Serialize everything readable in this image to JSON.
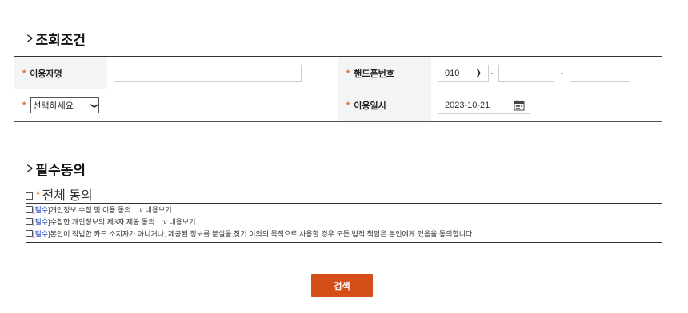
{
  "section1": {
    "title": "조회조건"
  },
  "conditions": {
    "user_name_label": "이용자명",
    "user_name_value": "",
    "phone_label": "핸드폰번호",
    "phone_prefix": "010",
    "phone_dash1": "-",
    "phone_dash2": "-",
    "phone_mid": "",
    "phone_last": "",
    "select_value": "선택하세요",
    "date_label": "이용일시",
    "date_value": "2023-10-21",
    "star": "*"
  },
  "section2": {
    "title": "필수동의"
  },
  "agreement": {
    "all_label": "전체 동의",
    "items": [
      {
        "req": "[필수]",
        "text": " 개인정보 수집 및 이용 동의",
        "more": "내용보기"
      },
      {
        "req": "[필수]",
        "text": " 수집한 개인정보의 제3자 제공 동의",
        "more": "내용보기"
      },
      {
        "req": "[필수]",
        "text": " 본인이 적법한 카드 소지자가 아니거나, 제공된 정보를 분실을 찾기 이외의 목적으로 사용할 경우 모든 법적 책임은 본인에게 있음을 동의합니다.",
        "more": ""
      }
    ]
  },
  "search_button": "검색",
  "colors": {
    "accent": "#d54e18",
    "required_star": "#e06a1b",
    "required_tag": "#1a3fbf"
  }
}
